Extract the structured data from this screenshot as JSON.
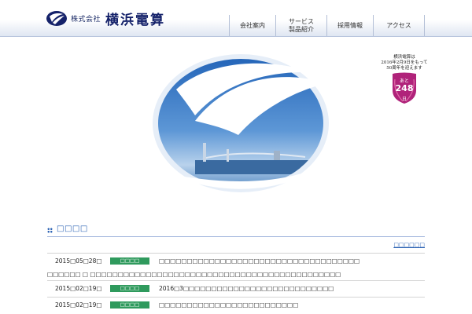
{
  "header": {
    "company_prefix": "株式会社",
    "company_name": "横浜電算"
  },
  "nav": {
    "items": [
      {
        "label": "会社案内"
      },
      {
        "label": "サービス\n製品紹介"
      },
      {
        "label": "採用情報"
      },
      {
        "label": "アクセス"
      }
    ]
  },
  "badge": {
    "line1": "横浜電算は",
    "line2": "2016年2月9日をもって",
    "line3": "50周年を迎えます",
    "prefix": "あと",
    "days": "248",
    "unit": "日"
  },
  "news": {
    "title": "□□□□",
    "more_link": "□□□□□□",
    "items": [
      {
        "date": "2015□05□28□",
        "tag": "□□□□",
        "text": "□□□□□□□□□□□□□□□□□□□□□□□□□□□□□□□□□□□□"
      },
      {
        "subtext": "□□□□□□ □ □□□□□□□□□□□□□□□□□□□□□□□□□□□□□□□□□□□□□□□□□□□□□"
      },
      {
        "date": "2015□02□19□",
        "tag": "□□□□",
        "text": "2016□3□□□□□□□□□□□□□□□□□□□□□□□□□□□"
      },
      {
        "date": "2015□02□19□",
        "tag": "□□□□",
        "text": "□□□□□□□□□□□□□□□□□□□□□□□□□"
      }
    ]
  },
  "colors": {
    "brand_navy": "#15226a",
    "accent_blue": "#2a61b3",
    "tag_green": "#2f9a5d",
    "badge_magenta": "#b0237a"
  }
}
